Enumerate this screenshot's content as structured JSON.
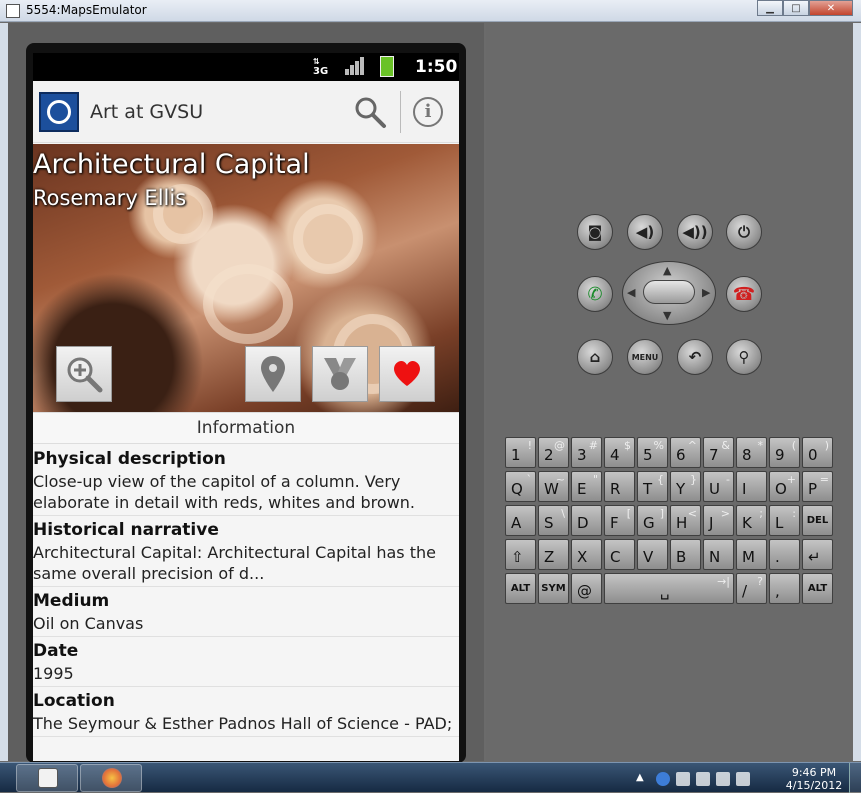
{
  "window": {
    "title": "5554:MapsEmulator"
  },
  "status_bar": {
    "network": "3G",
    "time": "1:50"
  },
  "app": {
    "title": "Art at GVSU",
    "artwork_title": "Architectural Capital",
    "artist": "Rosemary Ellis",
    "section_header": "Information",
    "details": [
      {
        "label": "Physical description",
        "value": "Close-up view of the capitol of a column.  Very elaborate in detail with reds, whites and brown."
      },
      {
        "label": "Historical narrative",
        "value": "Architectural Capital: Architectural Capital has the same overall precision of d..."
      },
      {
        "label": "Medium",
        "value": "Oil on Canvas"
      },
      {
        "label": "Date",
        "value": "1995"
      },
      {
        "label": "Location",
        "value": "The Seymour & Esther Padnos Hall of Science - PAD;"
      }
    ],
    "colors": {
      "favorite": "#ee1111",
      "logo": "#1c4f9c"
    }
  },
  "controls": {
    "menu_label": "MENU"
  },
  "keyboard": {
    "row1": [
      [
        "1",
        "!"
      ],
      [
        "2",
        "@"
      ],
      [
        "3",
        "#"
      ],
      [
        "4",
        "$"
      ],
      [
        "5",
        "%"
      ],
      [
        "6",
        "^"
      ],
      [
        "7",
        "&"
      ],
      [
        "8",
        "*"
      ],
      [
        "9",
        "("
      ],
      [
        "0",
        ")"
      ]
    ],
    "row2": [
      [
        "Q",
        "`"
      ],
      [
        "W",
        "~"
      ],
      [
        "E",
        "\""
      ],
      [
        "R",
        ""
      ],
      [
        "T",
        "{"
      ],
      [
        "Y",
        "}"
      ],
      [
        "U",
        "-"
      ],
      [
        "I",
        ""
      ],
      [
        "O",
        "+"
      ],
      [
        "P",
        "="
      ]
    ],
    "row3": [
      [
        "A",
        ""
      ],
      [
        "S",
        "\\"
      ],
      [
        "D",
        ""
      ],
      [
        "F",
        "["
      ],
      [
        "G",
        "]"
      ],
      [
        "H",
        "<"
      ],
      [
        "J",
        ">"
      ],
      [
        "K",
        ";"
      ],
      [
        "L",
        ":"
      ],
      [
        "DEL",
        ""
      ]
    ],
    "row4": [
      [
        "⇧",
        ""
      ],
      [
        "Z",
        ""
      ],
      [
        "X",
        ""
      ],
      [
        "C",
        ""
      ],
      [
        "V",
        ""
      ],
      [
        "B",
        ""
      ],
      [
        "N",
        ""
      ],
      [
        "M",
        ""
      ],
      [
        ".",
        ""
      ],
      [
        "↵",
        ""
      ]
    ],
    "row5": [
      [
        "ALT",
        ""
      ],
      [
        "SYM",
        ""
      ],
      [
        "@",
        ""
      ],
      [
        "␣",
        "→|"
      ],
      [
        "/",
        "?"
      ],
      [
        ",",
        ""
      ],
      [
        "ALT",
        ""
      ]
    ]
  },
  "taskbar": {
    "time": "9:46 PM",
    "date": "4/15/2012"
  }
}
